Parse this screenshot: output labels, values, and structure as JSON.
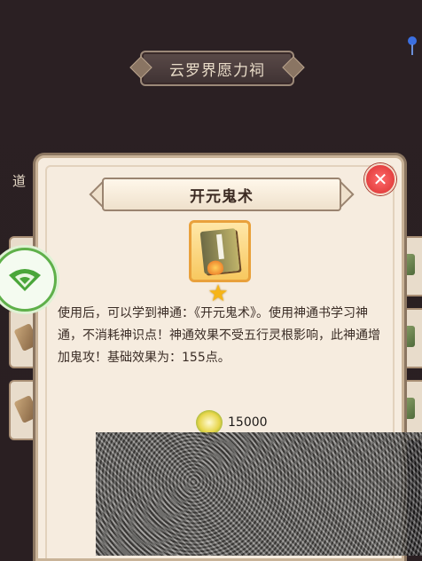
{
  "screen": {
    "title": "云罗界愿力祠",
    "side_text": "道",
    "corner_icon": "peacock-feather-icon"
  },
  "modal": {
    "title": "开元鬼术",
    "close_icon": "close-icon",
    "item_icon": "skill-book-icon",
    "star_icon": "star-icon",
    "star_glyph": "★",
    "close_glyph": "✕",
    "description": "使用后，可以学到神通：《开元鬼术》。使用神通书学习神通，不消耗神识点！神通效果不受五行灵根影响，此神通增加鬼攻！基础效果为：155点。",
    "cost": {
      "icon": "spirit-stone-icon",
      "value": "15000"
    }
  },
  "floating_button": {
    "icon": "wifi-icon"
  },
  "colors": {
    "background": "#2a1f22",
    "modal_bg": "#f6ecdf",
    "close_red": "#d92f2f",
    "star_gold": "#f6b517",
    "green": "#5fb04a"
  }
}
